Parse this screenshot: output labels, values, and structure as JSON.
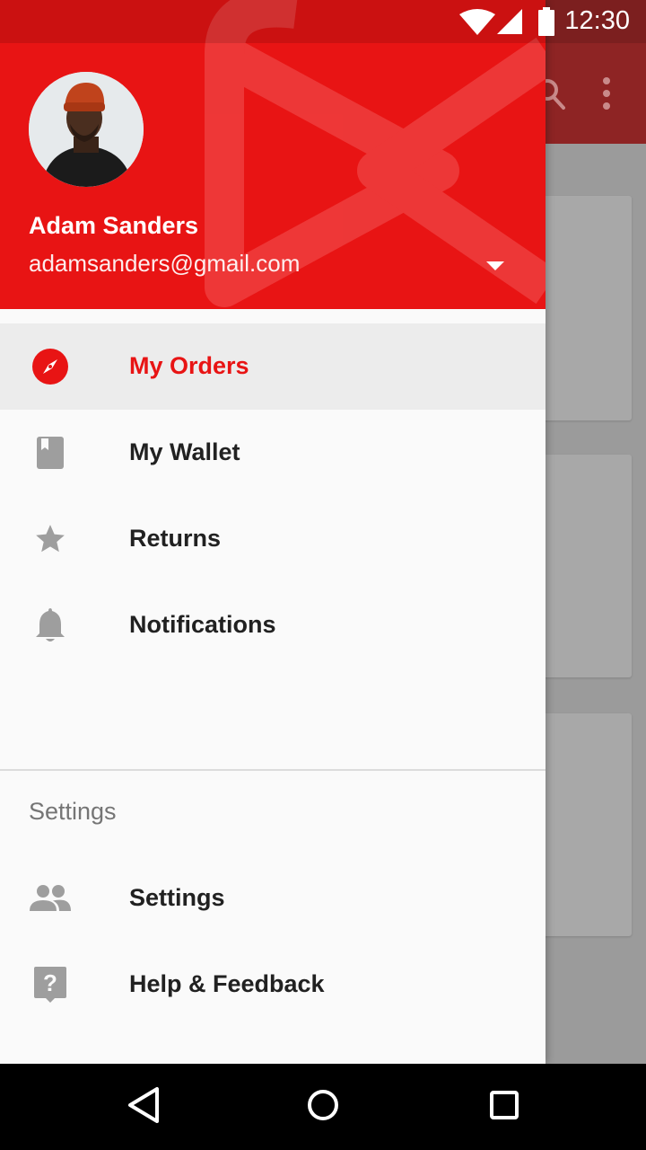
{
  "status_bar": {
    "time": "12:30"
  },
  "drawer": {
    "user": {
      "name": "Adam Sanders",
      "email": "adamsanders@gmail.com"
    },
    "items": [
      {
        "label": "My Orders",
        "icon": "compass-icon",
        "active": true
      },
      {
        "label": "My Wallet",
        "icon": "book-icon",
        "active": false
      },
      {
        "label": "Returns",
        "icon": "star-icon",
        "active": false
      },
      {
        "label": "Notifications",
        "icon": "bell-icon",
        "active": false
      }
    ],
    "section_title": "Settings",
    "settings_items": [
      {
        "label": "Settings",
        "icon": "people-icon"
      },
      {
        "label": "Help & Feedback",
        "icon": "help-icon"
      }
    ]
  },
  "colors": {
    "primary": "#e81414",
    "active_bg": "#ececec",
    "text": "#212121",
    "muted": "#757575"
  }
}
